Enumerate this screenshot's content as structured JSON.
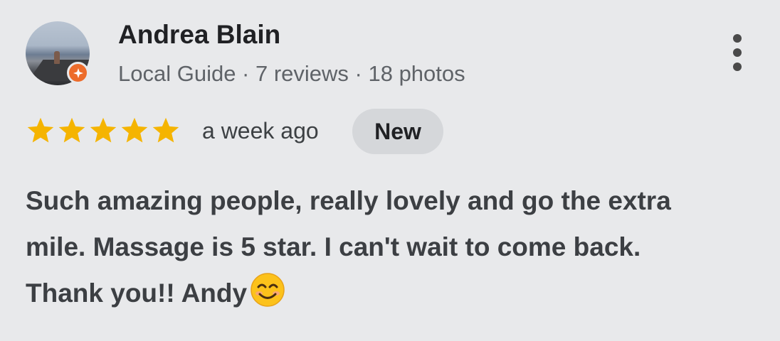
{
  "reviewer": {
    "name": "Andrea Blain",
    "meta": "Local Guide · 7 reviews · 18 photos",
    "avatar_icon": "profile-photo",
    "badge_icon": "local-guide-star-icon",
    "badge_color": "#ed6c2b"
  },
  "menu_icon": "more-vert-icon",
  "rating": {
    "stars": 5,
    "max": 5,
    "color": "#f5b400"
  },
  "time_ago": "a week ago",
  "new_label": "New",
  "review": {
    "line1": "Such amazing people, really lovely and go the extra",
    "line2": "mile. Massage is 5 star. I can't wait to come back.",
    "line3": "Thank you!! Andy",
    "emoji": "smiling-face-icon"
  }
}
